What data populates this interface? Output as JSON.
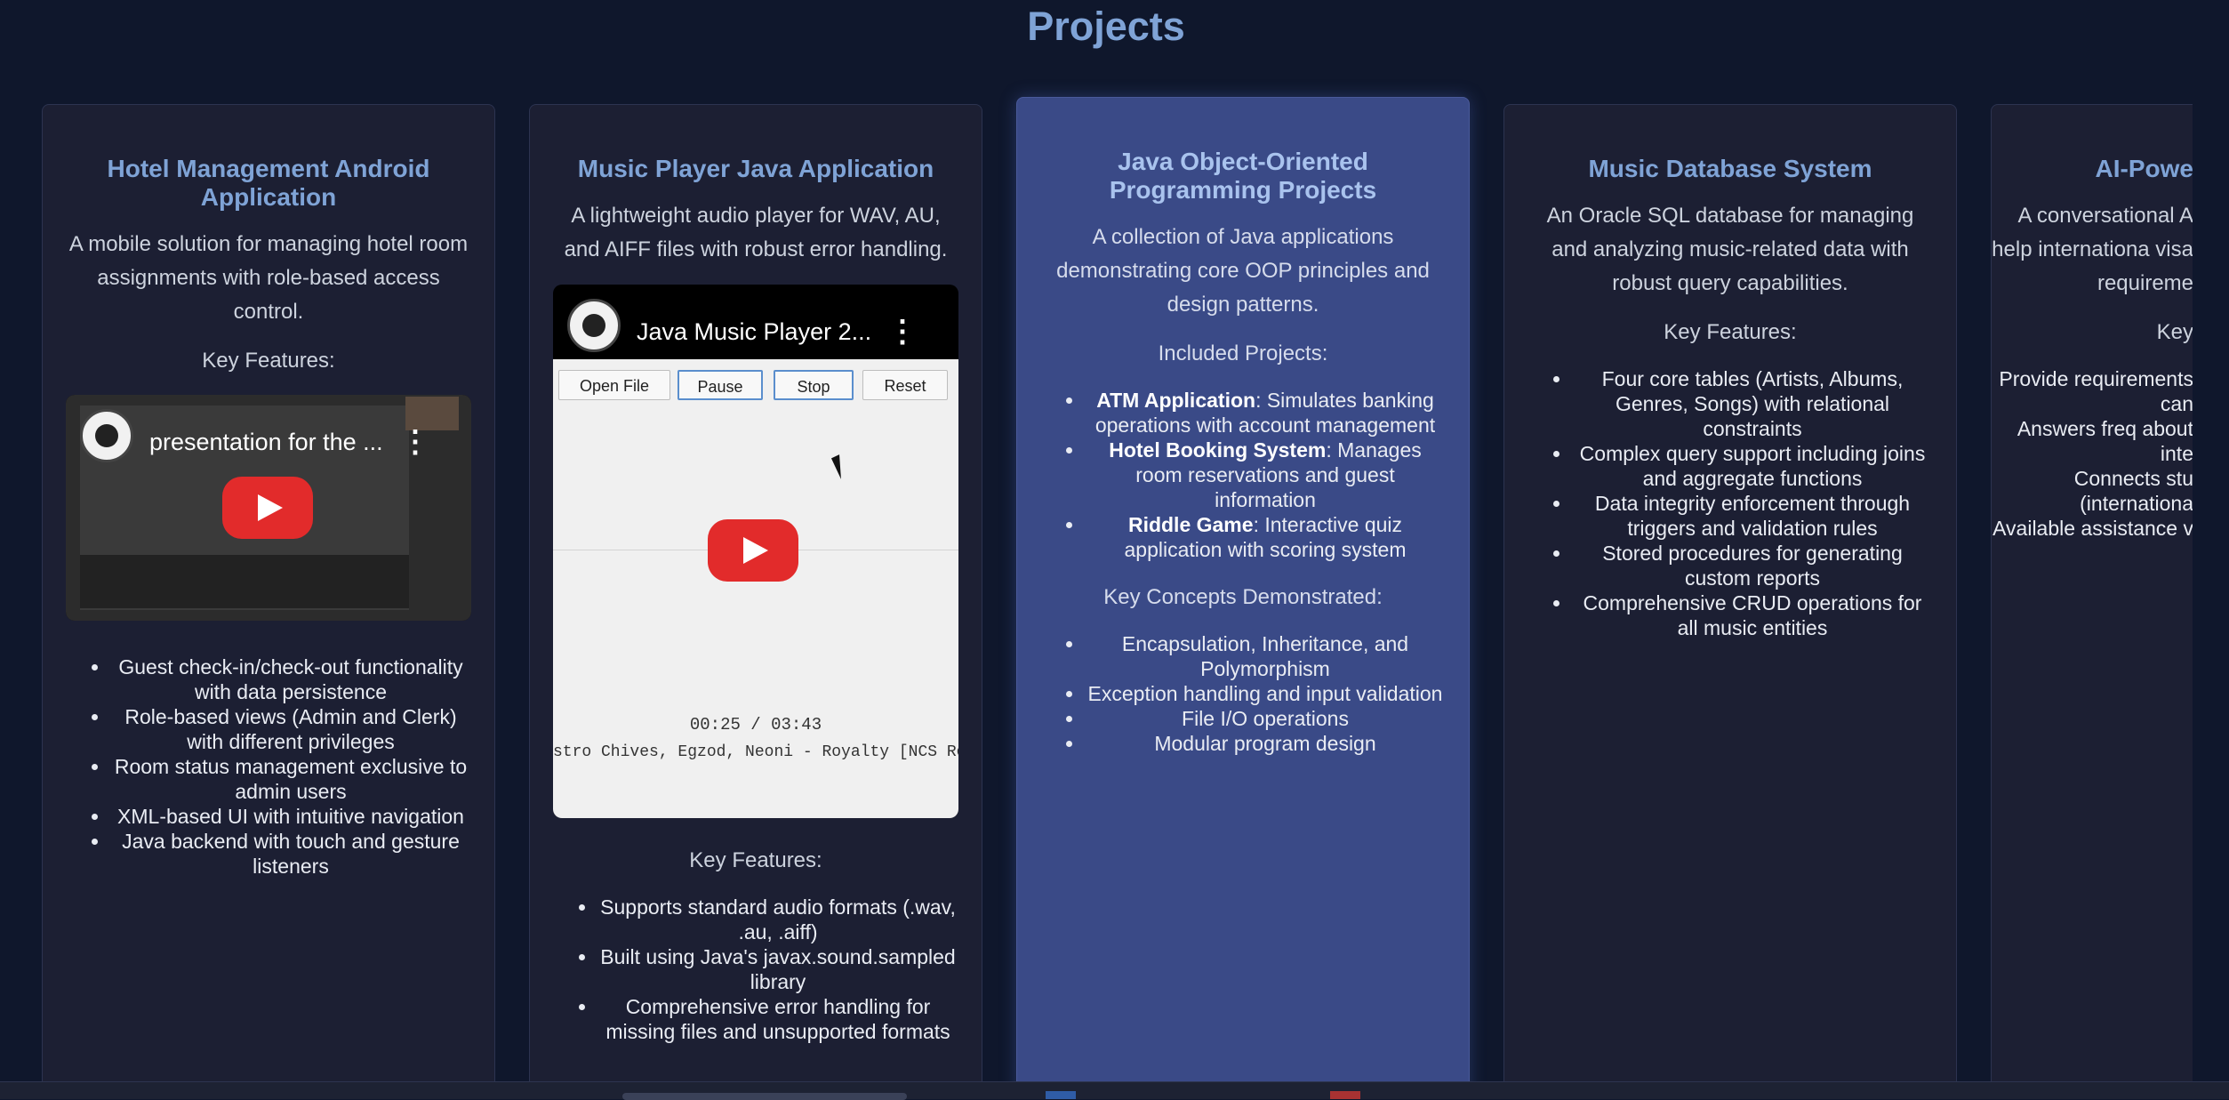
{
  "page": {
    "title": "Projects"
  },
  "cards": [
    {
      "title": "Hotel Management Android Application",
      "description": "A mobile solution for managing hotel room assignments with role-based access control.",
      "section1_label": "Key Features:",
      "video": {
        "title": "presentation for the ..."
      },
      "features": [
        "Guest check-in/check-out functionality with data persistence",
        "Role-based views (Admin and Clerk) with different privileges",
        "Room status management exclusive to admin users",
        "XML-based UI with intuitive navigation",
        "Java backend with touch and gesture listeners"
      ]
    },
    {
      "title": "Music Player Java Application",
      "description": "A lightweight audio player for WAV, AU, and AIFF files with robust error handling.",
      "video": {
        "title": "Java Music Player 2...",
        "buttons": [
          "Open File",
          "Pause",
          "Stop",
          "Reset"
        ],
        "time": "00:25  /  03:43",
        "track": "stro Chives, Egzod, Neoni - Royalty [NCS Release].wav"
      },
      "section1_label": "Key Features:",
      "features": [
        "Supports standard audio formats (.wav, .au, .aiff)",
        "Built using Java's javax.sound.sampled library",
        "Comprehensive error handling for missing files and unsupported formats"
      ]
    },
    {
      "title": "Java Object-Oriented Programming Projects",
      "description": "A collection of Java applications demonstrating core OOP principles and design patterns.",
      "section1_label": "Included Projects:",
      "projects": [
        {
          "name": "ATM Application",
          "desc": ": Simulates banking operations with account management"
        },
        {
          "name": "Hotel Booking System",
          "desc": ": Manages room reservations and guest information"
        },
        {
          "name": "Riddle Game",
          "desc": ": Interactive quiz application with scoring system"
        }
      ],
      "section2_label": "Key Concepts Demonstrated:",
      "concepts": [
        "Encapsulation, Inheritance, and Polymorphism",
        "Exception handling and input validation",
        "File I/O operations",
        "Modular program design"
      ]
    },
    {
      "title": "Music Database System",
      "description": "An Oracle SQL database for managing and analyzing music-related data with robust query capabilities.",
      "section1_label": "Key Features:",
      "features": [
        "Four core tables (Artists, Albums, Genres, Songs) with relational constraints",
        "Complex query support including joins and aggregate functions",
        "Data integrity enforcement through triggers and validation rules",
        "Stored procedures for generating custom reports",
        "Comprehensive CRUD operations for all music entities"
      ]
    },
    {
      "title": "AI-Powe",
      "description": "A conversational A help internationa visa requireme",
      "section1_label": "Key",
      "features": [
        "Provide requirements can",
        "Answers freq about inte",
        "Connects stu (internationa",
        "Available assistance v"
      ]
    }
  ]
}
